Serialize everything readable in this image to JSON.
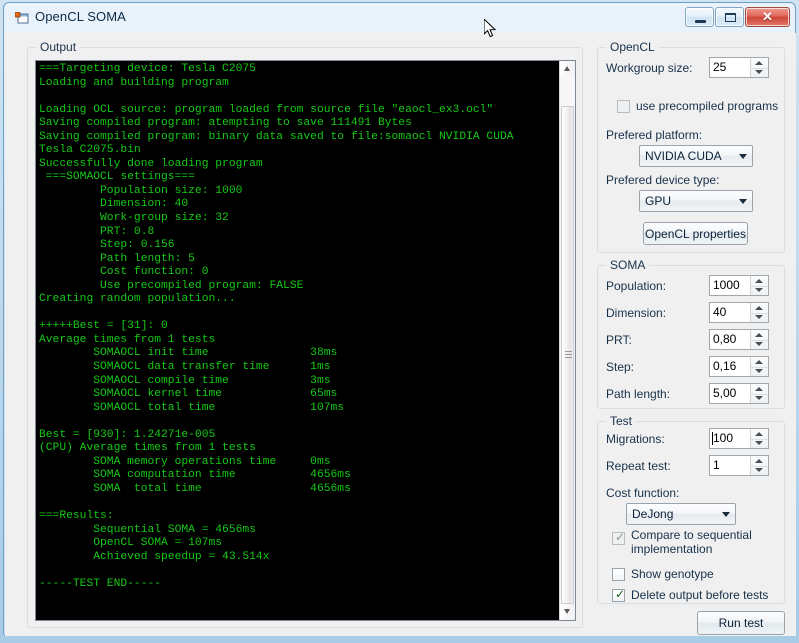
{
  "window": {
    "title": "OpenCL SOMA",
    "icon": "app-form-icon",
    "buttons": {
      "minimize": "minimize",
      "maximize": "maximize",
      "close": "✕"
    }
  },
  "output": {
    "group_title": "Output",
    "console_text": "===Targeting device: Tesla C2075\nLoading and building program\n\nLoading OCL source: program loaded from source file \"eaocl_ex3.ocl\"\nSaving compiled program: atempting to save 111491 Bytes\nSaving compiled program: binary data saved to file:somaocl NVIDIA CUDA\nTesla C2075.bin\nSuccessfully done loading program\n ===SOMAOCL settings===\n         Population size: 1000\n         Dimension: 40\n         Work-group size: 32\n         PRT: 0.8\n         Step: 0.156\n         Path length: 5\n         Cost function: 0\n         Use precompiled program: FALSE\nCreating random population...\n\n+++++Best = [31]: 0\nAverage times from 1 tests\n        SOMAOCL init time               38ms\n        SOMAOCL data transfer time      1ms\n        SOMAOCL compile time            3ms\n        SOMAOCL kernel time             65ms\n        SOMAOCL total time              107ms\n\nBest = [930]: 1.24271e-005\n(CPU) Average times from 1 tests\n        SOMA memory operations time     0ms\n        SOMA computation time           4656ms\n        SOMA  total time                4656ms\n\n===Results:\n        Sequential SOMA = 4656ms\n        OpenCL SOMA = 107ms\n        Achieved speedup = 43.514x\n\n-----TEST END-----\n",
    "scrollbar": {
      "up_arrow": "scroll-up",
      "down_arrow": "scroll-down"
    }
  },
  "opencl": {
    "group_title": "OpenCL",
    "workgroup_label": "Workgroup size:",
    "workgroup_value": "25",
    "precompiled_label": "use precompiled programs",
    "precompiled_checked": false,
    "platform_label": "Prefered platform:",
    "platform_value": "NVIDIA CUDA",
    "device_label": "Prefered device type:",
    "device_value": "GPU",
    "properties_button": "OpenCL properties"
  },
  "soma": {
    "group_title": "SOMA",
    "fields": [
      {
        "label": "Population:",
        "value": "1000"
      },
      {
        "label": "Dimension:",
        "value": "40"
      },
      {
        "label": "PRT:",
        "value": "0,80"
      },
      {
        "label": "Step:",
        "value": "0,16"
      },
      {
        "label": "Path length:",
        "value": "5,00"
      }
    ]
  },
  "test": {
    "group_title": "Test",
    "migrations_label": "Migrations:",
    "migrations_value": "100",
    "repeat_label": "Repeat test:",
    "repeat_value": "1",
    "cost_label": "Cost function:",
    "cost_value": "DeJong",
    "compare_label": "Compare to sequential implementation",
    "compare_checked": true,
    "genotype_label": "Show genotype",
    "genotype_checked": false,
    "delete_label": "Delete output before tests",
    "delete_checked": true,
    "run_button": "Run test"
  },
  "colors": {
    "console_bg": "#000000",
    "console_fg": "#16c916",
    "accent": "#a8cbe6",
    "close_button": "#cc4335"
  }
}
